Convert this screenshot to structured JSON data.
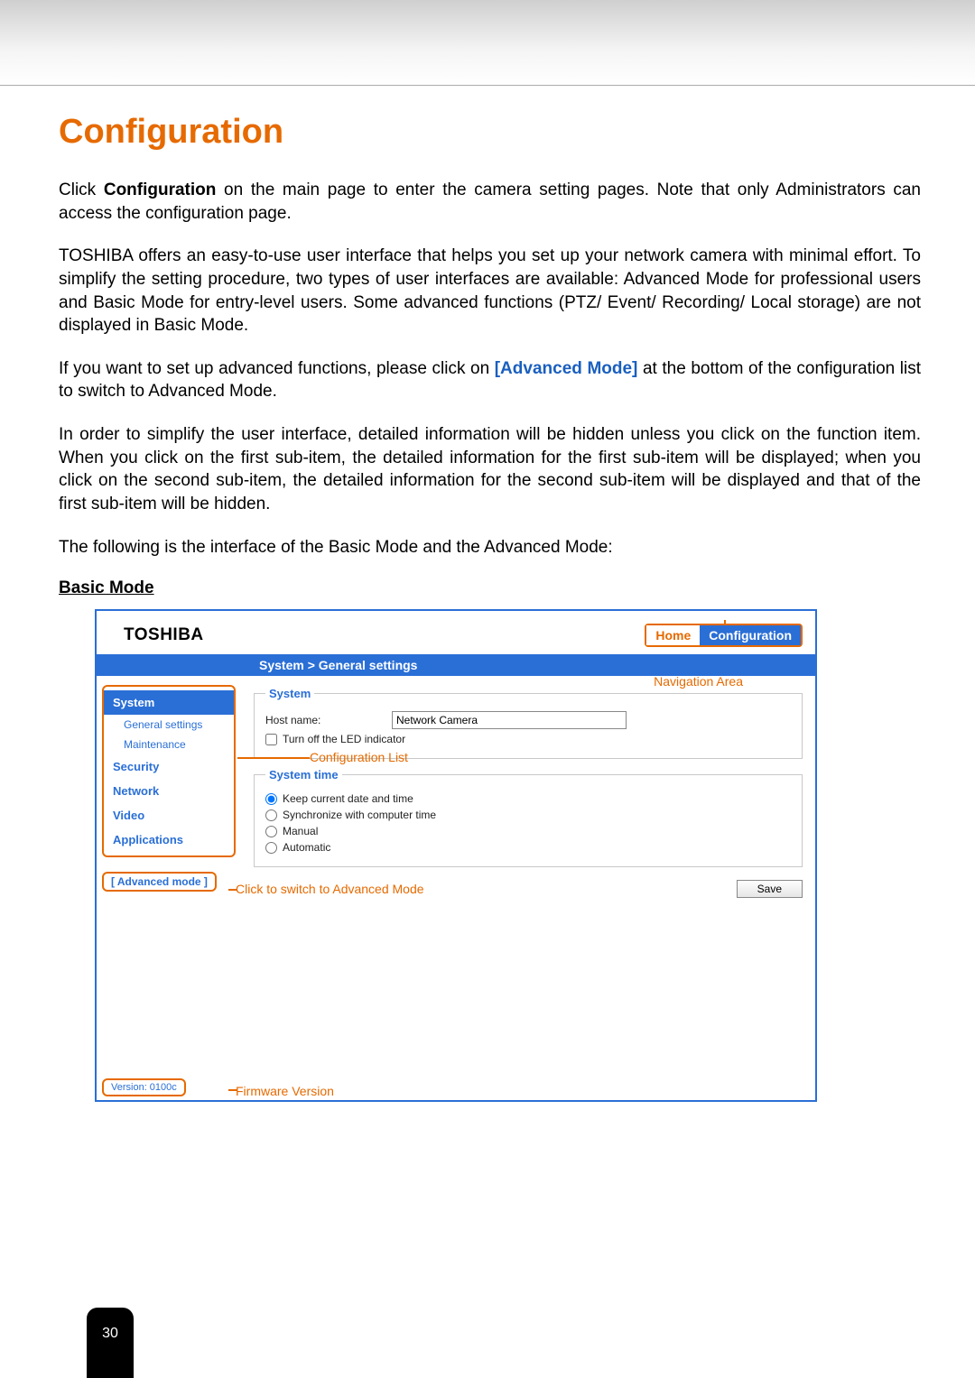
{
  "title": "Configuration",
  "para1_a": "Click ",
  "para1_b": "Configuration",
  "para1_c": " on the main page to enter the camera setting pages. Note that only Administrators can access the configuration page.",
  "para2": "TOSHIBA offers an easy-to-use user interface that helps you set up your network camera with minimal effort. To simplify the setting procedure, two types of user interfaces are available: Advanced Mode for professional users and Basic Mode for entry-level users. Some advanced functions (PTZ/ Event/ Recording/ Local storage) are not displayed in Basic Mode.",
  "para3_a": "If you want to set up advanced functions, please click on ",
  "para3_b": "[Advanced Mode]",
  "para3_c": " at the bottom of the configuration list to switch to Advanced Mode.",
  "para4": "In order to simplify the user interface, detailed information will be hidden unless you click on the function item. When you click on the first sub-item, the detailed information for the first sub-item will be displayed; when you click on the second sub-item, the detailed information for the second sub-item will be displayed and that of the first sub-item will be hidden.",
  "para5": "The following is the interface of the Basic Mode and the Advanced Mode:",
  "basic_mode_hdr": "Basic Mode",
  "shot": {
    "brand": "TOSHIBA",
    "home": "Home",
    "conf": "Configuration",
    "crumb": "System  >  General settings",
    "sidebar": {
      "system": "System",
      "general": "General settings",
      "maint": "Maintenance",
      "security": "Security",
      "network": "Network",
      "video": "Video",
      "apps": "Applications",
      "adv": "[ Advanced mode ]",
      "version": "Version: 0100c"
    },
    "grp_system": "System",
    "hostname_lbl": "Host name:",
    "hostname_val": "Network Camera",
    "led_lbl": "Turn off the LED indicator",
    "grp_time": "System time",
    "opt_keep": "Keep current date and time",
    "opt_sync": "Synchronize with computer time",
    "opt_manual": "Manual",
    "opt_auto": "Automatic",
    "save": "Save"
  },
  "annot": {
    "nav": "Navigation Area",
    "conflist": "Configuration List",
    "advswitch": "Click to switch to Advanced Mode",
    "fw": "Firmware Version"
  },
  "pagenum": "30"
}
